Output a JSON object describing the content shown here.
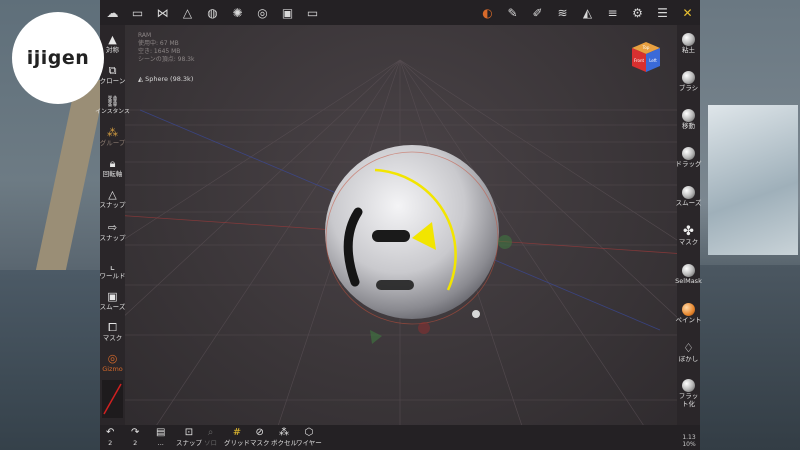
{
  "logo": {
    "text": "ijigen"
  },
  "stats": {
    "ram": "RAM",
    "used": "使用中: 67 MB",
    "free": "空き: 1645 MB",
    "scene": "シーンの頂点: 98.3k"
  },
  "mesh": {
    "label": "Sphere (98.3k)"
  },
  "cube": {
    "front": "Front",
    "right": "Left",
    "top": "Top"
  },
  "left_toolbar": [
    {
      "icon": "triangle-icon",
      "label": "対称"
    },
    {
      "icon": "clone-icon",
      "label": "クローン"
    },
    {
      "icon": "link-icon",
      "label": "インスタンス"
    },
    {
      "icon": "group-icon",
      "label": "グループ"
    },
    {
      "icon": "lock-icon",
      "label": "回転軸"
    },
    {
      "icon": "triangle-outline-icon",
      "label": "スナップ"
    },
    {
      "icon": "arrow-right-icon",
      "label": "スナップ"
    },
    {
      "icon": "world-axis-icon",
      "label": "ワールド"
    },
    {
      "icon": "smooth-icon",
      "label": "スムーズ"
    },
    {
      "icon": "mask-icon",
      "label": "マスク"
    },
    {
      "icon": "gizmo-icon",
      "label": "Gizmo"
    }
  ],
  "right_toolbar": [
    {
      "label": "粘土"
    },
    {
      "label": "ブラシ"
    },
    {
      "label": "移動"
    },
    {
      "label": "ドラッグ"
    },
    {
      "label": "スムーズ"
    },
    {
      "label": "マスク"
    },
    {
      "label": "SelMask"
    },
    {
      "label": "ペイント"
    },
    {
      "label": "ぼかし"
    },
    {
      "label": "フラット化"
    }
  ],
  "bottom_toolbar": [
    {
      "icon": "undo-icon",
      "label": "2"
    },
    {
      "icon": "redo-icon",
      "label": "2"
    },
    {
      "icon": "history-icon",
      "label": "..."
    },
    {
      "icon": "camera-snap-icon",
      "label": "スナップ"
    },
    {
      "icon": "solo-icon",
      "label": "ソロ"
    },
    {
      "icon": "grid-icon",
      "label": "グリッド"
    },
    {
      "icon": "mask-eye-icon",
      "label": "マスク"
    },
    {
      "icon": "voxel-icon",
      "label": "ボクセル"
    },
    {
      "icon": "wireframe-icon",
      "label": "ワイヤー"
    }
  ],
  "zoom": {
    "line1": "1.13",
    "line2": "10%"
  },
  "colors": {
    "accent": "#f2e500",
    "toolbar": "#242124",
    "gizmo": "#d86a2a"
  }
}
